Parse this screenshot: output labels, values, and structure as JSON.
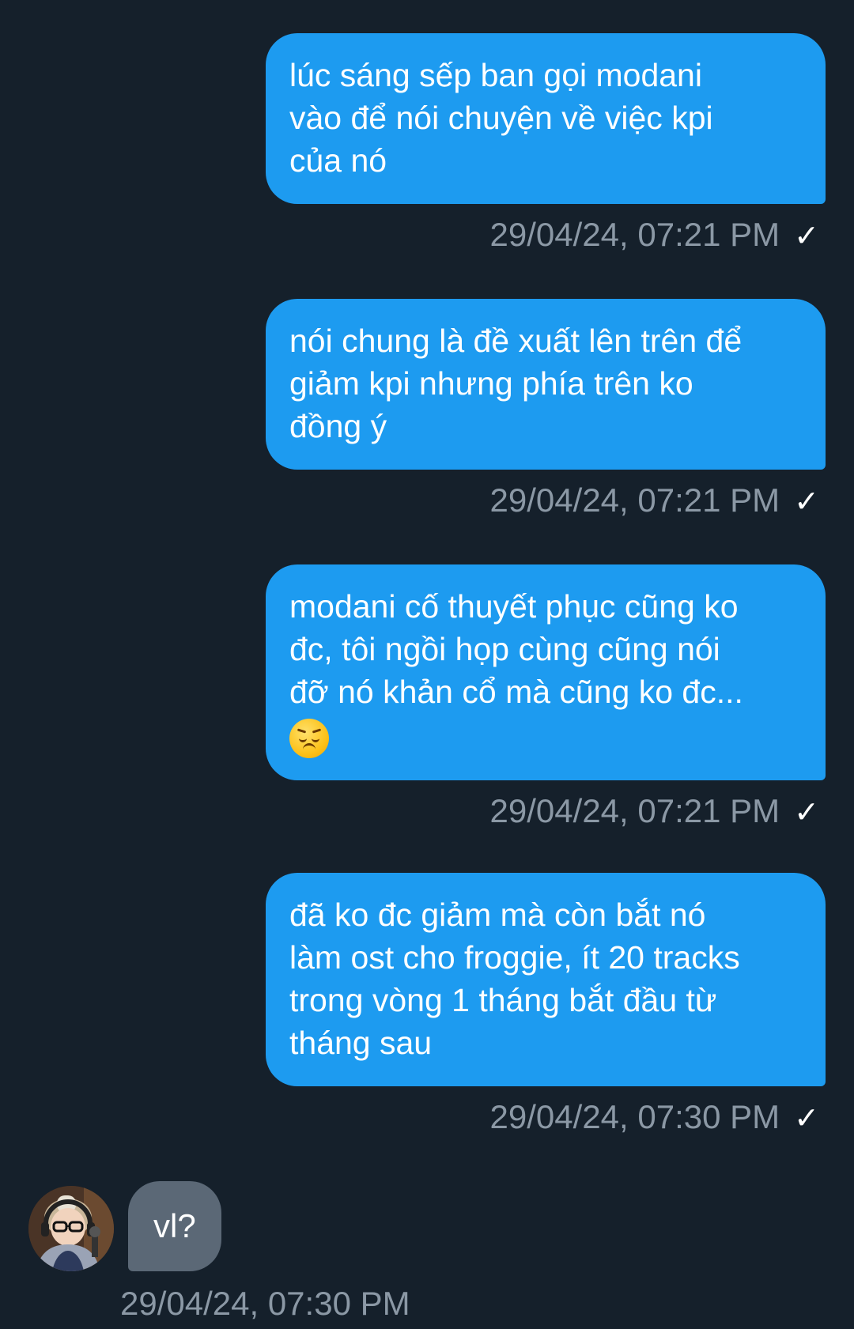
{
  "messages_sent": [
    {
      "text": "lúc sáng sếp ban gọi modani\nvào để nói chuyện về việc kpi\ncủa nó",
      "timestamp": "29/04/24, 07:21 PM",
      "status_icon": "single-check-icon"
    },
    {
      "text": "nói chung là đề xuất lên trên để\ngiảm kpi nhưng phía trên ko\nđồng ý",
      "timestamp": "29/04/24, 07:21 PM",
      "status_icon": "single-check-icon"
    },
    {
      "text": "modani cố thuyết phục cũng ko\nđc, tôi ngồi họp cùng cũng nói\nđỡ nó khản cổ mà cũng ko đc...",
      "emoji": "disappointed-face-emoji",
      "timestamp": "29/04/24, 07:21 PM",
      "status_icon": "single-check-icon"
    },
    {
      "text": "đã ko đc giảm mà còn bắt nó\nlàm ost cho froggie, ít 20 tracks\ntrong vòng 1 tháng bắt đầu từ\ntháng sau",
      "timestamp": "29/04/24, 07:30 PM",
      "status_icon": "single-check-icon"
    }
  ],
  "message_received": {
    "text": "vl?",
    "timestamp": "29/04/24, 07:30 PM",
    "avatar": "user-avatar-photo"
  },
  "colors": {
    "background": "#15202b",
    "sent_bubble": "#1d9bf0",
    "received_bubble": "#5b6876",
    "timestamp_text": "#8b98a5"
  }
}
